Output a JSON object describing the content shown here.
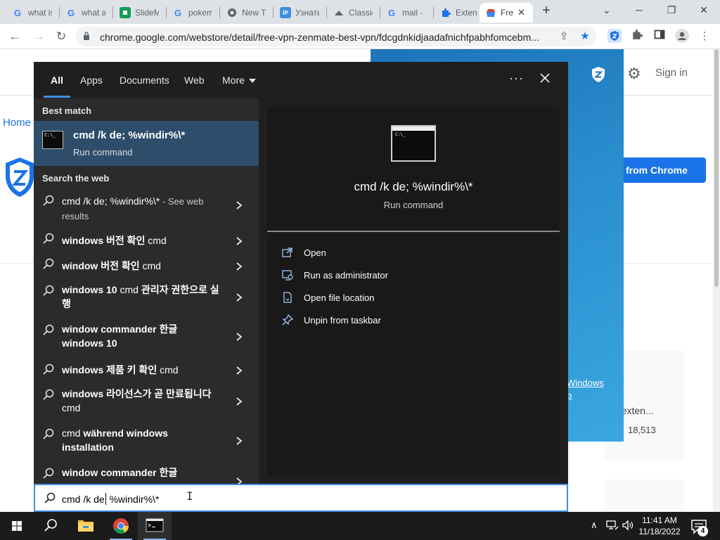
{
  "browser": {
    "tabs": [
      {
        "label": "what is",
        "icon": "google-icon"
      },
      {
        "label": "what a",
        "icon": "google-icon"
      },
      {
        "label": "SlideM",
        "icon": "slides-icon"
      },
      {
        "label": "pokem",
        "icon": "google-icon"
      },
      {
        "label": "New T",
        "icon": "chrome-icon"
      },
      {
        "label": "Узнать",
        "icon": "ip-icon"
      },
      {
        "label": "Classic",
        "icon": "classic-icon"
      },
      {
        "label": "mail -",
        "icon": "google-icon"
      },
      {
        "label": "Extens",
        "icon": "puzzle-icon"
      },
      {
        "label": "Fre",
        "icon": "webstore-icon",
        "active": true
      }
    ],
    "url": "chrome.google.com/webstore/detail/free-vpn-zenmate-best-vpn/fdcgdnkidjaadafnichfpabhfomcebm...",
    "new_tab_symbol": "+"
  },
  "webpage": {
    "signin": "Sign in",
    "home_link": "Home",
    "cta_button": "from Chrome",
    "card_title": "e exten...",
    "card_rating_count": "18,513",
    "zen_link_line1": "Windows",
    "zen_link_line2": "p"
  },
  "search": {
    "tabs": [
      "All",
      "Apps",
      "Documents",
      "Web",
      "More"
    ],
    "more_options": "···",
    "best_match_label": "Best match",
    "best_match": {
      "title": "cmd /k de; %windir%\\*",
      "subtitle": "Run command"
    },
    "web_label": "Search the web",
    "web_results": [
      {
        "bold": "cmd /k de; %windir%\\*",
        "grey": " - See web results"
      },
      {
        "bold": "windows 버전 확인",
        "norm": " cmd"
      },
      {
        "bold": "window 버전 확인",
        "norm": " cmd"
      },
      {
        "bold": "windows 10",
        "norm": " cmd ",
        "bold2": "관리자 권한으로 실행"
      },
      {
        "bold": "window commander 한글 windows 10"
      },
      {
        "bold": "windows 제품 키 확인",
        "norm": " cmd"
      },
      {
        "bold": "windows 라이선스가 곧 만료됩니다",
        "norm": " cmd"
      },
      {
        "norm0": "cmd ",
        "bold": "während windows installation"
      },
      {
        "bold": "window commander 한글"
      }
    ],
    "preview": {
      "title": "cmd /k de; %windir%\\*",
      "subtitle": "Run command",
      "actions": [
        {
          "label": "Open",
          "icon": "open-icon"
        },
        {
          "label": "Run as administrator",
          "icon": "admin-icon"
        },
        {
          "label": "Open file location",
          "icon": "file-location-icon"
        },
        {
          "label": "Unpin from taskbar",
          "icon": "unpin-icon"
        }
      ]
    },
    "query_before_caret": "cmd /k de",
    "query_after_caret": " %windir%\\*"
  },
  "taskbar": {
    "time": "11:41 AM",
    "date": "11/18/2022",
    "notification_count": "4"
  },
  "colors": {
    "accent": "#3f8ede",
    "selected": "#2e4d6b",
    "chrome_blue": "#1a73e8"
  }
}
